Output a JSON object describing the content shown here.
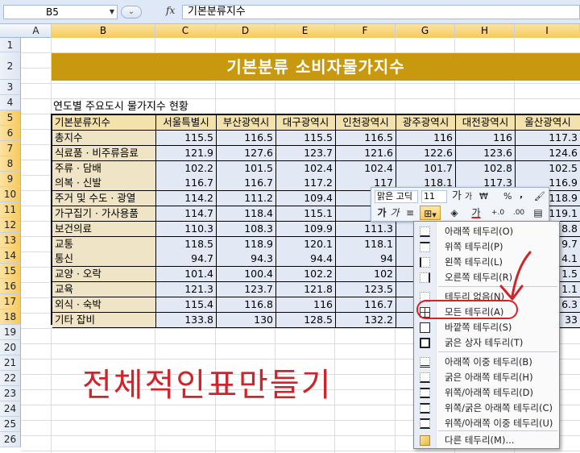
{
  "formula_bar": {
    "name_box": "B5",
    "fx_label": "fx",
    "formula_value": "기본분류지수"
  },
  "columns": [
    {
      "label": "A"
    },
    {
      "label": "B"
    },
    {
      "label": "C"
    },
    {
      "label": "D"
    },
    {
      "label": "E"
    },
    {
      "label": "F"
    },
    {
      "label": "G"
    },
    {
      "label": "H"
    },
    {
      "label": "I"
    }
  ],
  "rows": [
    "1",
    "2",
    "3",
    "4",
    "5",
    "6",
    "7",
    "8",
    "9",
    "10",
    "11",
    "12",
    "13",
    "14",
    "15",
    "16",
    "17",
    "18",
    "19",
    "20",
    "21",
    "22",
    "23",
    "24",
    "25",
    "26"
  ],
  "sheet": {
    "title": "기본분류 소비자물가지수",
    "subtitle": "연도별 주요도시 물가지수 현황",
    "headers": [
      "기본분류지수",
      "서울특별시",
      "부산광역시",
      "대구광역시",
      "인천광역시",
      "광주광역시",
      "대전광역시",
      "울산광역시"
    ],
    "table": [
      {
        "label": "총지수",
        "values": [
          "115.5",
          "116.5",
          "115.5",
          "116.5",
          "116",
          "116",
          "117.3"
        ]
      },
      {
        "label": "식료품 · 비주류음료",
        "values": [
          "121.9",
          "127.6",
          "123.7",
          "121.6",
          "122.6",
          "123.6",
          "124.6"
        ]
      },
      {
        "label": "주류 · 담배",
        "values": [
          "102.2",
          "101.5",
          "102.4",
          "102.4",
          "101.7",
          "102.8",
          "102.5"
        ]
      },
      {
        "label": "의복 · 신발",
        "values": [
          "116.7",
          "116.7",
          "117.2",
          "117",
          "118.1",
          "117.3",
          "116.9"
        ]
      },
      {
        "label": "주거 및 수도 · 광열",
        "values": [
          "114.2",
          "111.2",
          "109.4",
          "",
          "",
          "",
          "118.9"
        ]
      },
      {
        "label": "가구집기 · 가사용품",
        "values": [
          "114.7",
          "118.4",
          "115.1",
          "",
          "",
          "",
          "119.1"
        ]
      },
      {
        "label": "보건의료",
        "values": [
          "110.3",
          "108.3",
          "109.9",
          "111.3",
          "",
          "",
          "8.8"
        ]
      },
      {
        "label": "교통",
        "values": [
          "118.5",
          "118.9",
          "120.1",
          "118.1",
          "",
          "",
          "9.7"
        ]
      },
      {
        "label": "통신",
        "values": [
          "94.7",
          "94.3",
          "94.4",
          "94",
          "",
          "",
          "4.1"
        ]
      },
      {
        "label": "교양 · 오락",
        "values": [
          "101.4",
          "100.4",
          "102.2",
          "102",
          "",
          "",
          "1.5"
        ]
      },
      {
        "label": "교육",
        "values": [
          "121.3",
          "123.7",
          "121.8",
          "123.5",
          "",
          "",
          "1.1"
        ]
      },
      {
        "label": "외식 · 숙박",
        "values": [
          "115.4",
          "116.8",
          "116",
          "116.7",
          "",
          "",
          "6.3"
        ]
      },
      {
        "label": "기타 잡비",
        "values": [
          "133.8",
          "130",
          "128.5",
          "132.2",
          "",
          "",
          "33"
        ]
      }
    ],
    "annotation": "전체적인표만들기"
  },
  "mini_toolbar": {
    "font_name": "맑은 고딕",
    "font_size": "11",
    "grow_font": "가",
    "shrink_font": "가",
    "currency": "₩",
    "percent": "%",
    "comma": ",",
    "bold": "가",
    "italic": "가",
    "align": "≡",
    "font_color": "가",
    "inc_decimal": "+.0",
    "dec_decimal": ".00"
  },
  "border_menu": {
    "items": [
      "아래쪽 테두리(O)",
      "위쪽 테두리(P)",
      "왼쪽 테두리(L)",
      "오른쪽 테두리(R)",
      "테두리 없음(N)",
      "모든 테두리(A)",
      "바깥쪽 테두리(S)",
      "굵은 상자 테두리(T)",
      "아래쪽 이중 테두리(B)",
      "굵은 아래쪽 테두리(H)",
      "위쪽/아래쪽 테두리(D)",
      "위쪽/굵은 아래쪽 테두리(C)",
      "위쪽/아래쪽 이중 테두리(U)",
      "다른 테두리(M)..."
    ]
  },
  "colors": {
    "title_bg": "#c8990f",
    "header_bg": "#f3e2ac",
    "label_bg": "#efe4c6",
    "value_bg": "#e3e9f4",
    "annotation_red": "#d1232a"
  }
}
